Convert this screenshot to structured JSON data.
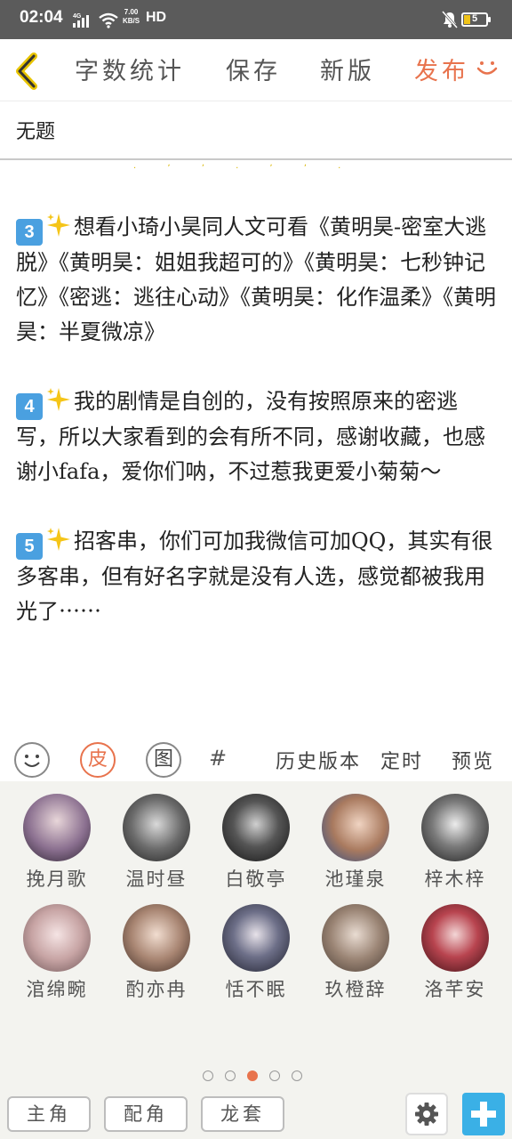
{
  "status_bar": {
    "time": "02:04",
    "network_type": "4G",
    "speed_value": "7.00",
    "speed_unit": "KB/S",
    "hd": "HD",
    "battery": "5"
  },
  "toolbar": {
    "word_count": "字数统计",
    "save": "保存",
    "new_version": "新版",
    "publish": "发布"
  },
  "title": "无题",
  "sparkles": "· ʼ ʼ · ʼ ʼ ·",
  "paragraphs": [
    {
      "number": "3",
      "text": "想看小琦小昊同人文可看《黄明昊-密室大逃脱》《黄明昊：姐姐我超可的》《黄明昊：七秒钟记忆》《密逃：逃往心动》《黄明昊：化作温柔》《黄明昊：半夏微凉》"
    },
    {
      "number": "4",
      "text": "我的剧情是自创的，没有按照原来的密逃写，所以大家看到的会有所不同，感谢收藏，也感谢小fafa，爱你们呐，不过惹我更爱小菊菊～"
    },
    {
      "number": "5",
      "text": "招客串，你们可加我微信可加QQ，其实有很多客串，但有好名字就是没有人选，感觉都被我用光了⋯⋯"
    }
  ],
  "editor_bar": {
    "skin": "皮",
    "image": "图",
    "hash": "#",
    "history": "历史版本",
    "schedule": "定时",
    "preview": "预览"
  },
  "roles": [
    {
      "name": "挽月歌",
      "color": "#8a6f8f"
    },
    {
      "name": "温时昼",
      "color": "#4a4a4a"
    },
    {
      "name": "白敬亭",
      "color": "#2f2f2f"
    },
    {
      "name": "池瑾泉",
      "color": "#8d6a58"
    },
    {
      "name": "梓木梓",
      "color": "#3a3a3a"
    },
    {
      "name": "涫绵畹",
      "color": "#c7a4a4"
    },
    {
      "name": "酌亦冉",
      "color": "#a88572"
    },
    {
      "name": "恬不眠",
      "color": "#3d3f52"
    },
    {
      "name": "玖橙辞",
      "color": "#9a8474"
    },
    {
      "name": "洛芊安",
      "color": "#9b2f3a"
    }
  ],
  "pagination": {
    "total": 5,
    "active": 3
  },
  "bottom_tabs": {
    "lead": "主角",
    "supporting": "配角",
    "extra": "龙套"
  },
  "colors": {
    "accent": "#e8734d",
    "plus_button": "#3ab0e6",
    "number_badge": "#4aa0e0"
  }
}
